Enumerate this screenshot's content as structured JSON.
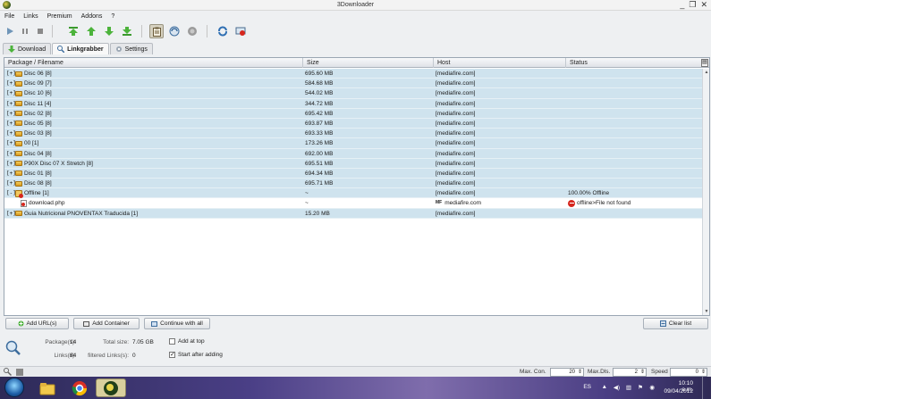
{
  "window": {
    "title": "3Downloader",
    "controls": [
      "_",
      "❐",
      "✕"
    ]
  },
  "menu": [
    "File",
    "Links",
    "Premium",
    "Addons",
    "?"
  ],
  "tabs": [
    {
      "label": "Download",
      "active": false
    },
    {
      "label": "Linkgrabber",
      "active": true
    },
    {
      "label": "Settings",
      "active": false
    }
  ],
  "columns": [
    "Package / Filename",
    "Size",
    "Host",
    "Status"
  ],
  "rows": [
    {
      "expand": "[+]",
      "name": "Disc 06 [8]",
      "size": "695.60 MB",
      "host": "[mediafire.com]",
      "status": ""
    },
    {
      "expand": "[+]",
      "name": "Disc 09 [7]",
      "size": "584.68 MB",
      "host": "[mediafire.com]",
      "status": ""
    },
    {
      "expand": "[+]",
      "name": "Disc 10 [6]",
      "size": "544.02 MB",
      "host": "[mediafire.com]",
      "status": ""
    },
    {
      "expand": "[+]",
      "name": "Disc 11 [4]",
      "size": "344.72 MB",
      "host": "[mediafire.com]",
      "status": ""
    },
    {
      "expand": "[+]",
      "name": "Disc 02 [8]",
      "size": "695.42 MB",
      "host": "[mediafire.com]",
      "status": ""
    },
    {
      "expand": "[+]",
      "name": "Disc 05 [8]",
      "size": "693.87 MB",
      "host": "[mediafire.com]",
      "status": ""
    },
    {
      "expand": "[+]",
      "name": "Disc 03 [8]",
      "size": "693.33 MB",
      "host": "[mediafire.com]",
      "status": ""
    },
    {
      "expand": "[+]",
      "name": "00 [1]",
      "size": "173.26 MB",
      "host": "[mediafire.com]",
      "status": ""
    },
    {
      "expand": "[+]",
      "name": "Disc 04 [8]",
      "size": "692.00 MB",
      "host": "[mediafire.com]",
      "status": ""
    },
    {
      "expand": "[+]",
      "name": "P90X Disc 07 X Stretch [8]",
      "size": "695.51 MB",
      "host": "[mediafire.com]",
      "status": ""
    },
    {
      "expand": "[+]",
      "name": "Disc 01 [8]",
      "size": "694.34 MB",
      "host": "[mediafire.com]",
      "status": ""
    },
    {
      "expand": "[+]",
      "name": "Disc 08 [8]",
      "size": "695.71 MB",
      "host": "[mediafire.com]",
      "status": ""
    }
  ],
  "offline_row": {
    "expand": "[-]",
    "name": "Offline [1]",
    "size": "~",
    "host": "[mediafire.com]",
    "status": "100.00% Offline"
  },
  "offline_child": {
    "name": "download.php",
    "size": "~",
    "host": "mediafire.com",
    "status": "offline>File not found"
  },
  "last_row": {
    "expand": "[+]",
    "name": "Guia Nutricional PNOVENTAX Traducida [1]",
    "size": "15.20 MB",
    "host": "[mediafire.com]",
    "status": ""
  },
  "buttons": {
    "add_urls": "Add URL(s)",
    "add_container": "Add Container",
    "continue_all": "Continue with all",
    "clear_list": "Clear list"
  },
  "info": {
    "packages_label": "Package(s):",
    "packages_value": "14",
    "total_size_label": "Total size:",
    "total_size_value": "7.05 GB",
    "links_label": "Links(s):",
    "links_value": "84",
    "filtered_label": "filtered Links(s):",
    "filtered_value": "0",
    "add_at_top": "Add at top",
    "start_after_adding": "Start after adding",
    "add_at_top_checked": false,
    "start_after_adding_checked": true
  },
  "statusbar": {
    "max_con_label": "Max. Con.",
    "max_con_value": "20",
    "max_dls_label": "Max.Dls.",
    "max_dls_value": "2",
    "speed_label": "Speed",
    "speed_value": "0"
  },
  "taskbar": {
    "lang": "ES",
    "time": "10:10 a.m.",
    "date": "09/04/2012"
  },
  "colors": {
    "row_bg": "#cfe3ee",
    "accent": "#2e7d32",
    "error": "#d6271e"
  }
}
